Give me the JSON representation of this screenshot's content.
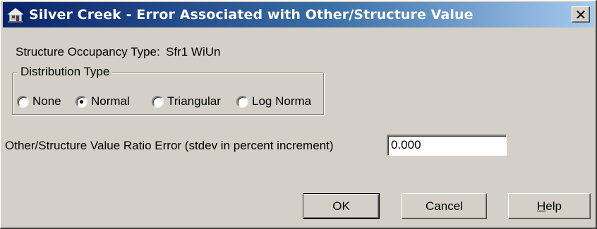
{
  "window": {
    "title": "Silver Creek - Error Associated with Other/Structure Value",
    "close_glyph": "✕"
  },
  "occupancy": {
    "label": "Structure Occupancy Type:",
    "value": "Sfr1 WiUn"
  },
  "distribution": {
    "legend": "Distribution Type",
    "options": [
      {
        "label": "None",
        "checked": false
      },
      {
        "label": "Normal",
        "checked": true
      },
      {
        "label": "Triangular",
        "checked": false
      },
      {
        "label": "Log Norma",
        "checked": false
      }
    ]
  },
  "ratio_error": {
    "label": "Other/Structure Value Ratio Error (stdev in percent increment)",
    "value": "0.000"
  },
  "buttons": {
    "ok": "OK",
    "cancel": "Cancel",
    "help_mnemonic": "H",
    "help_rest": "elp"
  }
}
